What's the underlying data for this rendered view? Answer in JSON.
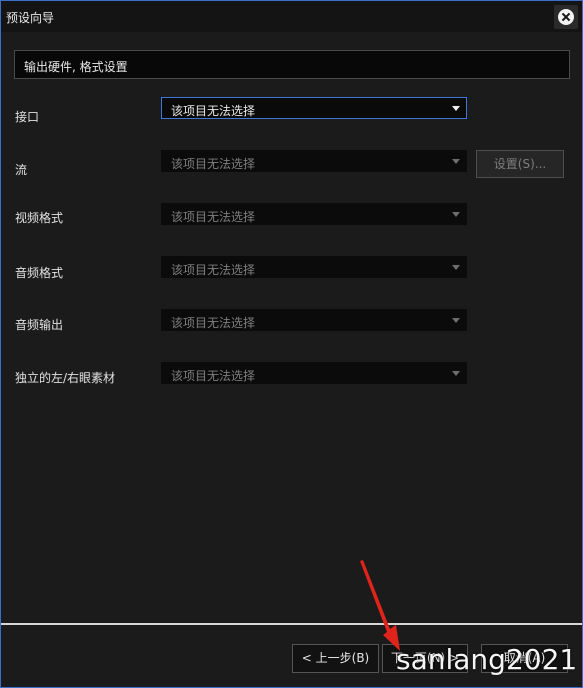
{
  "window": {
    "title": "预设向导"
  },
  "step": {
    "title": "输出硬件, 格式设置"
  },
  "rows": [
    {
      "label": "接口",
      "value": "该项目无法选择",
      "enabled": true
    },
    {
      "label": "流",
      "value": "该项目无法选择",
      "enabled": false
    },
    {
      "label": "视频格式",
      "value": "该项目无法选择",
      "enabled": false
    },
    {
      "label": "音频格式",
      "value": "该项目无法选择",
      "enabled": false
    },
    {
      "label": "音频输出",
      "value": "该项目无法选择",
      "enabled": false
    },
    {
      "label": "独立的左/右眼素材",
      "value": "该项目无法选择",
      "enabled": false
    }
  ],
  "settings_button": {
    "label": "设置(S)..."
  },
  "footer": {
    "back_label": "< 上一步(B)",
    "next_label": "下一页(N) >",
    "cancel_label": "取消(A)"
  },
  "watermark": {
    "text": "sanlang2021"
  },
  "colors": {
    "accent": "#3e78d6",
    "annotation_arrow": "#e0231b"
  }
}
